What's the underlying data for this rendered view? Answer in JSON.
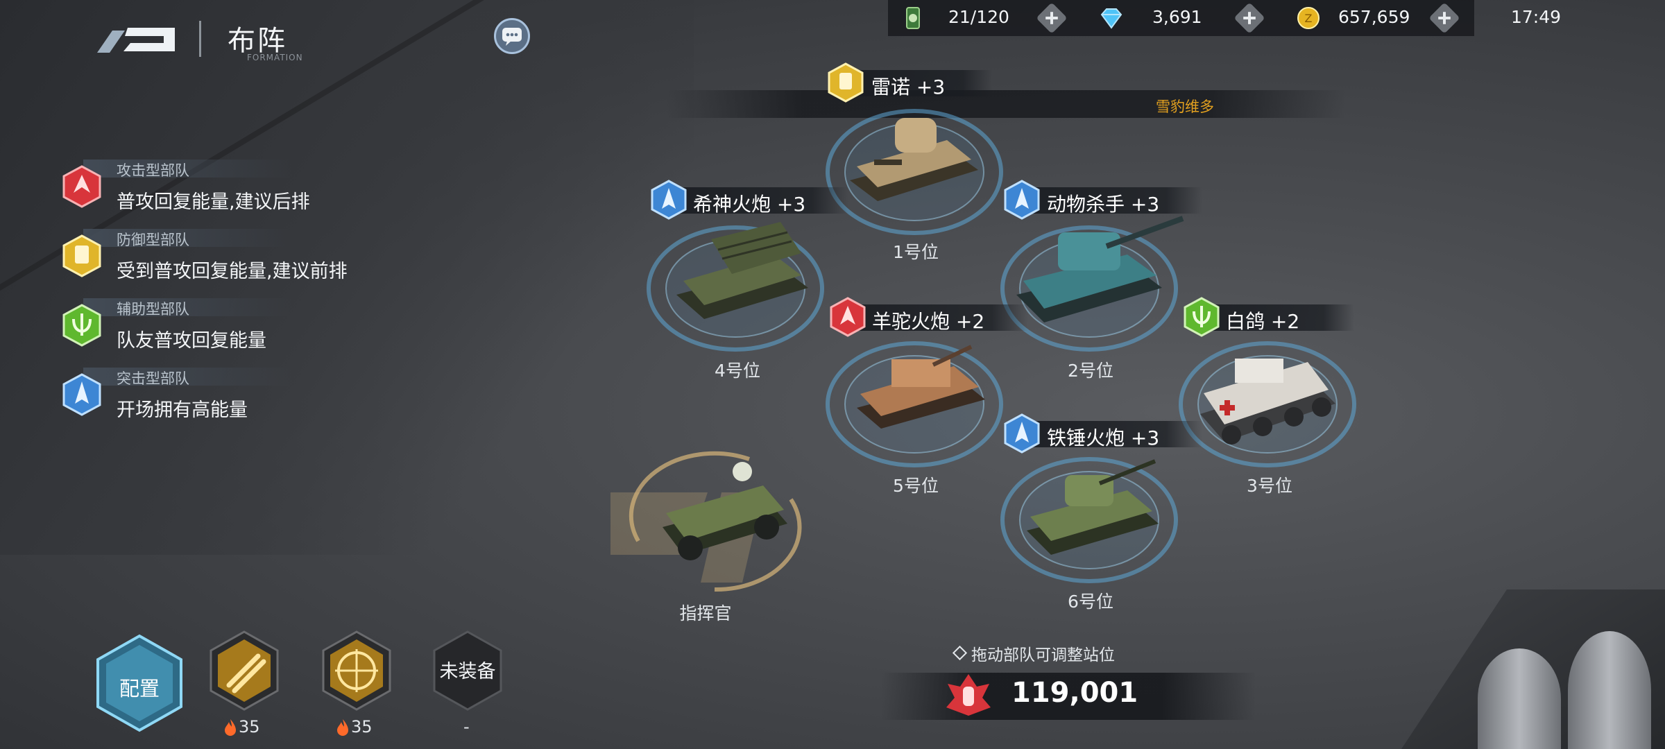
{
  "header": {
    "title": "布阵",
    "subtitle": "FORMATION"
  },
  "resources": {
    "energy": "21/120",
    "diamonds": "3,691",
    "coins": "657,659",
    "time": "17:49"
  },
  "banner": {
    "location_name": "雪豹维多"
  },
  "roles": [
    {
      "type": "攻击型部队",
      "desc": "普攻回复能量,建议后排",
      "color": "#d8353b"
    },
    {
      "type": "防御型部队",
      "desc": "受到普攻回复能量,建议前排",
      "color": "#e0b52a"
    },
    {
      "type": "辅助型部队",
      "desc": "队友普攻回复能量",
      "color": "#5fb82e"
    },
    {
      "type": "突击型部队",
      "desc": "开场拥有高能量",
      "color": "#3d86d4"
    }
  ],
  "units": {
    "slot1": {
      "name": "雷诺 +3",
      "label": "1号位",
      "role_icon": "defense-icon"
    },
    "slot2": {
      "name": "动物杀手 +3",
      "label": "2号位",
      "role_icon": "assault-icon"
    },
    "slot3": {
      "name": "白鸽 +2",
      "label": "3号位",
      "role_icon": "support-icon"
    },
    "slot4": {
      "name": "希神火炮 +3",
      "label": "4号位",
      "role_icon": "assault-icon"
    },
    "slot5": {
      "name": "羊驼火炮 +2",
      "label": "5号位",
      "role_icon": "attack-icon"
    },
    "slot6": {
      "name": "铁锤火炮 +3",
      "label": "6号位",
      "role_icon": "assault-icon"
    },
    "commander": {
      "label": "指挥官"
    }
  },
  "bottom": {
    "hint": "拖动部队可调整站位",
    "power": "119,001",
    "config_label": "配置",
    "equip1_value": "35",
    "equip2_value": "35",
    "unequipped_label": "未装备",
    "unequipped_value": "-"
  },
  "colors": {
    "accent_gold": "#e3a11f",
    "ring_blue": "#5fa8d6"
  }
}
